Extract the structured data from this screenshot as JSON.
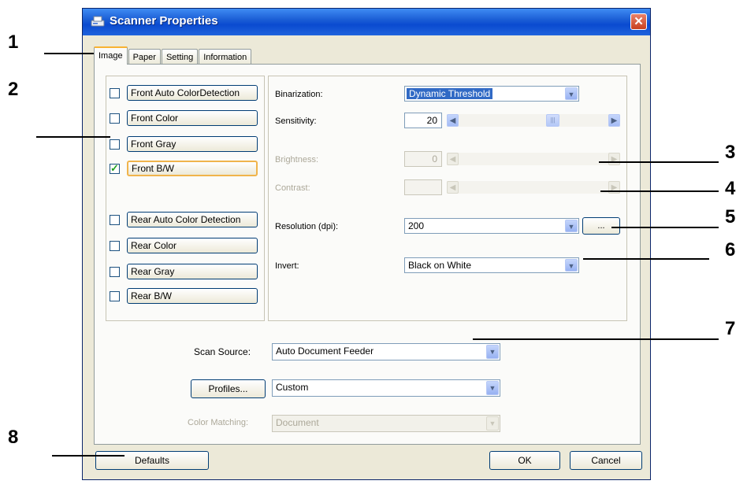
{
  "window": {
    "title": "Scanner Properties",
    "close_glyph": "✕"
  },
  "tabs": [
    {
      "label": "Image",
      "active": true
    },
    {
      "label": "Paper"
    },
    {
      "label": "Setting"
    },
    {
      "label": "Information"
    }
  ],
  "image_options": [
    {
      "label": "Front Auto ColorDetection",
      "checked": false
    },
    {
      "label": "Front Color",
      "checked": false
    },
    {
      "label": "Front Gray",
      "checked": false
    },
    {
      "label": "Front B/W",
      "checked": true
    },
    {
      "label": "Rear Auto Color Detection",
      "checked": false
    },
    {
      "label": "Rear Color",
      "checked": false
    },
    {
      "label": "Rear Gray",
      "checked": false
    },
    {
      "label": "Rear B/W",
      "checked": false
    }
  ],
  "settings": {
    "binarization_label": "Binarization:",
    "binarization_value": "Dynamic Threshold",
    "sensitivity_label": "Sensitivity:",
    "sensitivity_value": "20",
    "brightness_label": "Brightness:",
    "brightness_value": "0",
    "contrast_label": "Contrast:",
    "contrast_value": "",
    "resolution_label": "Resolution (dpi):",
    "resolution_value": "200",
    "resolution_more": "...",
    "invert_label": "Invert:",
    "invert_value": "Black on White"
  },
  "bottom": {
    "scan_source_label": "Scan Source:",
    "scan_source_value": "Auto Document Feeder",
    "profiles_button": "Profiles...",
    "profiles_value": "Custom",
    "color_matching_label": "Color Matching:",
    "color_matching_value": "Document"
  },
  "footer": {
    "defaults": "Defaults",
    "ok": "OK",
    "cancel": "Cancel"
  },
  "callouts": [
    "1",
    "2",
    "3",
    "4",
    "5",
    "6",
    "7",
    "8"
  ],
  "colors": {
    "titlebar": "#0a4ad0",
    "accent_focus": "#f0b44c",
    "selection": "#316ac5",
    "check": "#21a121"
  }
}
